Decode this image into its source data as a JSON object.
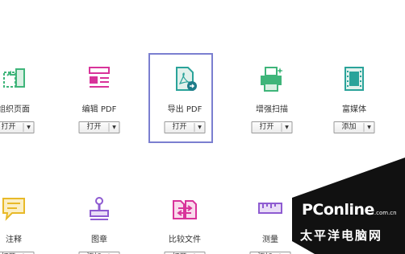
{
  "tools_row1": [
    {
      "name": "组织页面",
      "button": "打开"
    },
    {
      "name": "编辑 PDF",
      "button": "打开"
    },
    {
      "name": "导出 PDF",
      "button": "打开"
    },
    {
      "name": "增强扫描",
      "button": "打开"
    },
    {
      "name": "富媒体",
      "button": "添加"
    }
  ],
  "tools_row2": [
    {
      "name": "注释",
      "button": "打开"
    },
    {
      "name": "图章",
      "button": "添加"
    },
    {
      "name": "比较文件",
      "button": "打开"
    },
    {
      "name": "测量",
      "button": "添加"
    }
  ],
  "watermark": {
    "brand": "PConline",
    "domain": ".com.cn",
    "cn": "太平洋电脑网"
  },
  "icons": {
    "organize": "organize-pages-icon",
    "edit": "edit-pdf-icon",
    "export": "export-pdf-icon",
    "scan": "enhance-scan-icon",
    "media": "rich-media-icon",
    "comment": "comment-icon",
    "stamp": "stamp-icon",
    "compare": "compare-files-icon",
    "measure": "measure-icon"
  },
  "colors": {
    "green": "#3fb57a",
    "magenta": "#d8339a",
    "teal": "#2aa39a",
    "yellow": "#e8b928",
    "purple": "#8e5bd1",
    "selection": "#7b7fd0"
  }
}
